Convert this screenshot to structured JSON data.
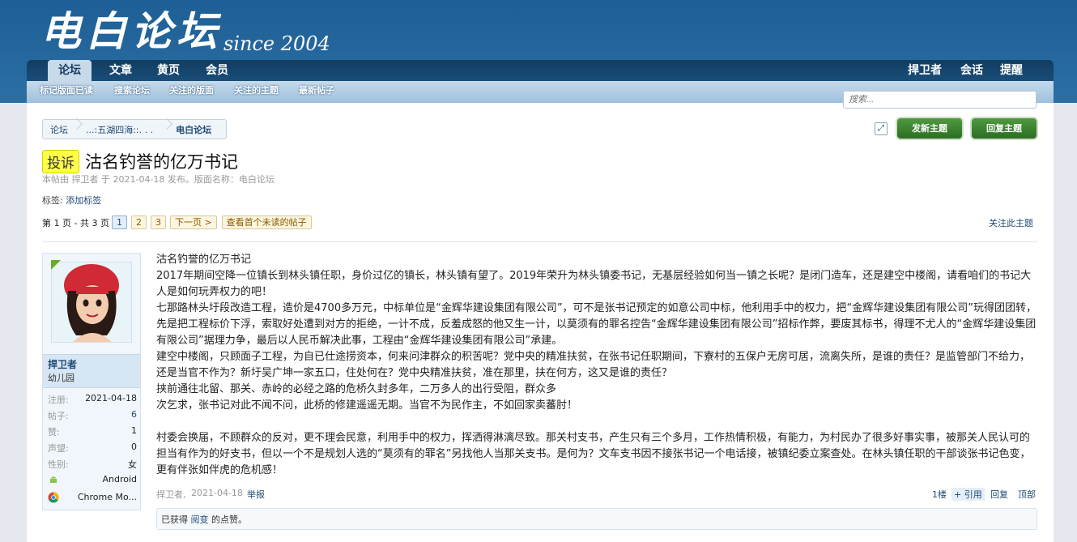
{
  "site": {
    "logo_text": "电白论坛",
    "since": "since 2004"
  },
  "nav": {
    "tabs": [
      "论坛",
      "文章",
      "黄页",
      "会员"
    ],
    "right": [
      "捍卫者",
      "会话",
      "提醒"
    ],
    "sub": [
      "标记版面已读",
      "搜索论坛",
      "关注的版面",
      "关注的主题",
      "最新帖子"
    ]
  },
  "search": {
    "placeholder": "搜索..."
  },
  "breadcrumb": [
    "论坛",
    "...:五湖四海::. . .",
    "电白论坛"
  ],
  "buttons": {
    "new_thread": "发新主题",
    "reply": "回复主题"
  },
  "thread": {
    "prefix": "投诉",
    "title": "沽名钓誉的亿万书记",
    "meta": "本帖由 捍卫者 于 2021-04-18 发布。版面名称：电白论坛",
    "tags_label": "标签:",
    "add_tag": "添加标签"
  },
  "pagination": {
    "summary": "第 1 页 - 共 3 页",
    "pages": [
      "1",
      "2",
      "3"
    ],
    "next": "下一页 >",
    "first_unread": "查看首个未读的帖子",
    "watch": "关注此主题"
  },
  "user": {
    "name": "捍卫者",
    "title": "幼儿园",
    "stats": [
      {
        "k": "注册:",
        "v": "2021-04-18"
      },
      {
        "k": "帖子:",
        "v": "6"
      },
      {
        "k": "赞:",
        "v": "1"
      },
      {
        "k": "声望:",
        "v": "0"
      },
      {
        "k": "性别:",
        "v": "女"
      }
    ],
    "os": "Android",
    "browser": "Chrome Mo..."
  },
  "post": {
    "paragraphs": [
      "沽名钓誉的亿万书记",
      "2017年期间空降一位镇长到林头镇任职，身价过亿的镇长，林头镇有望了。2019年荣升为林头镇委书记，无基层经验如何当一镇之长呢？是闭门造车，还是建空中楼阁，请看咱们的书记大人是如何玩弄权力的吧！",
      "七那路林头圩段改造工程，造价是4700多万元，中标单位是“金辉华建设集团有限公司”，可不是张书记预定的如意公司中标，他利用手中的权力，把“金辉华建设集团有限公司”玩得团团转，先是把工程标价下浮，索取好处遭到对方的拒绝，一计不成，反羞成怒的他又生一计，以莫须有的罪名控告“金辉华建设集团有限公司”招标作弊，要废其标书，得理不尤人的“金辉华建设集团有限公司”据理力争，最后以人民币解决此事，工程由“金辉华建设集团有限公司”承建。",
      "建空中楼阁，只顾面子工程，为自已仕途捞资本，何来问津群众的积苦呢？党中央的精准扶贫，在张书记任职期间，下寮村的五保户无房可居，流离失所，是谁的责任？是监管部门不给力，还是当官不作为？新圩吴广坤一家五口，住处何在？党中央精准扶贫，准在那里，扶在何方，这又是谁的责任？",
      "挟前通往北留、那关、赤岭的必经之路的危桥久封多年，二万多人的出行受阻，群众多",
      "次乞求，张书记对此不闻不问，此桥的修建遥遥无期。当官不为民作主，不如回家卖蕃肘！",
      "",
      "村委会换届，不顾群众的反对，更不理会民意，利用手中的权力，挥洒得淋漓尽致。那关村支书，产生只有三个多月，工作热情积极，有能力，为村民办了很多好事实事，被那关人民认可的担当有作为的好支书，但以一个不是规划人选的“莫须有的罪名”另找他人当那关支书。是何为？文车支书因不接张书记一个电话接，被镇纪委立案查处。在林头镇任职的干部谈张书记色变，更有伴张如伴虎的危机感！"
    ],
    "footer_author": "捍卫者,",
    "footer_date": "2021-04-18",
    "report": "举报",
    "floor": "1楼",
    "quote": "+ 引用",
    "reply": "回复",
    "top": "顶部",
    "likes_prefix": "已获得",
    "likes_user": "阅变",
    "likes_suffix": "的点赞。"
  }
}
